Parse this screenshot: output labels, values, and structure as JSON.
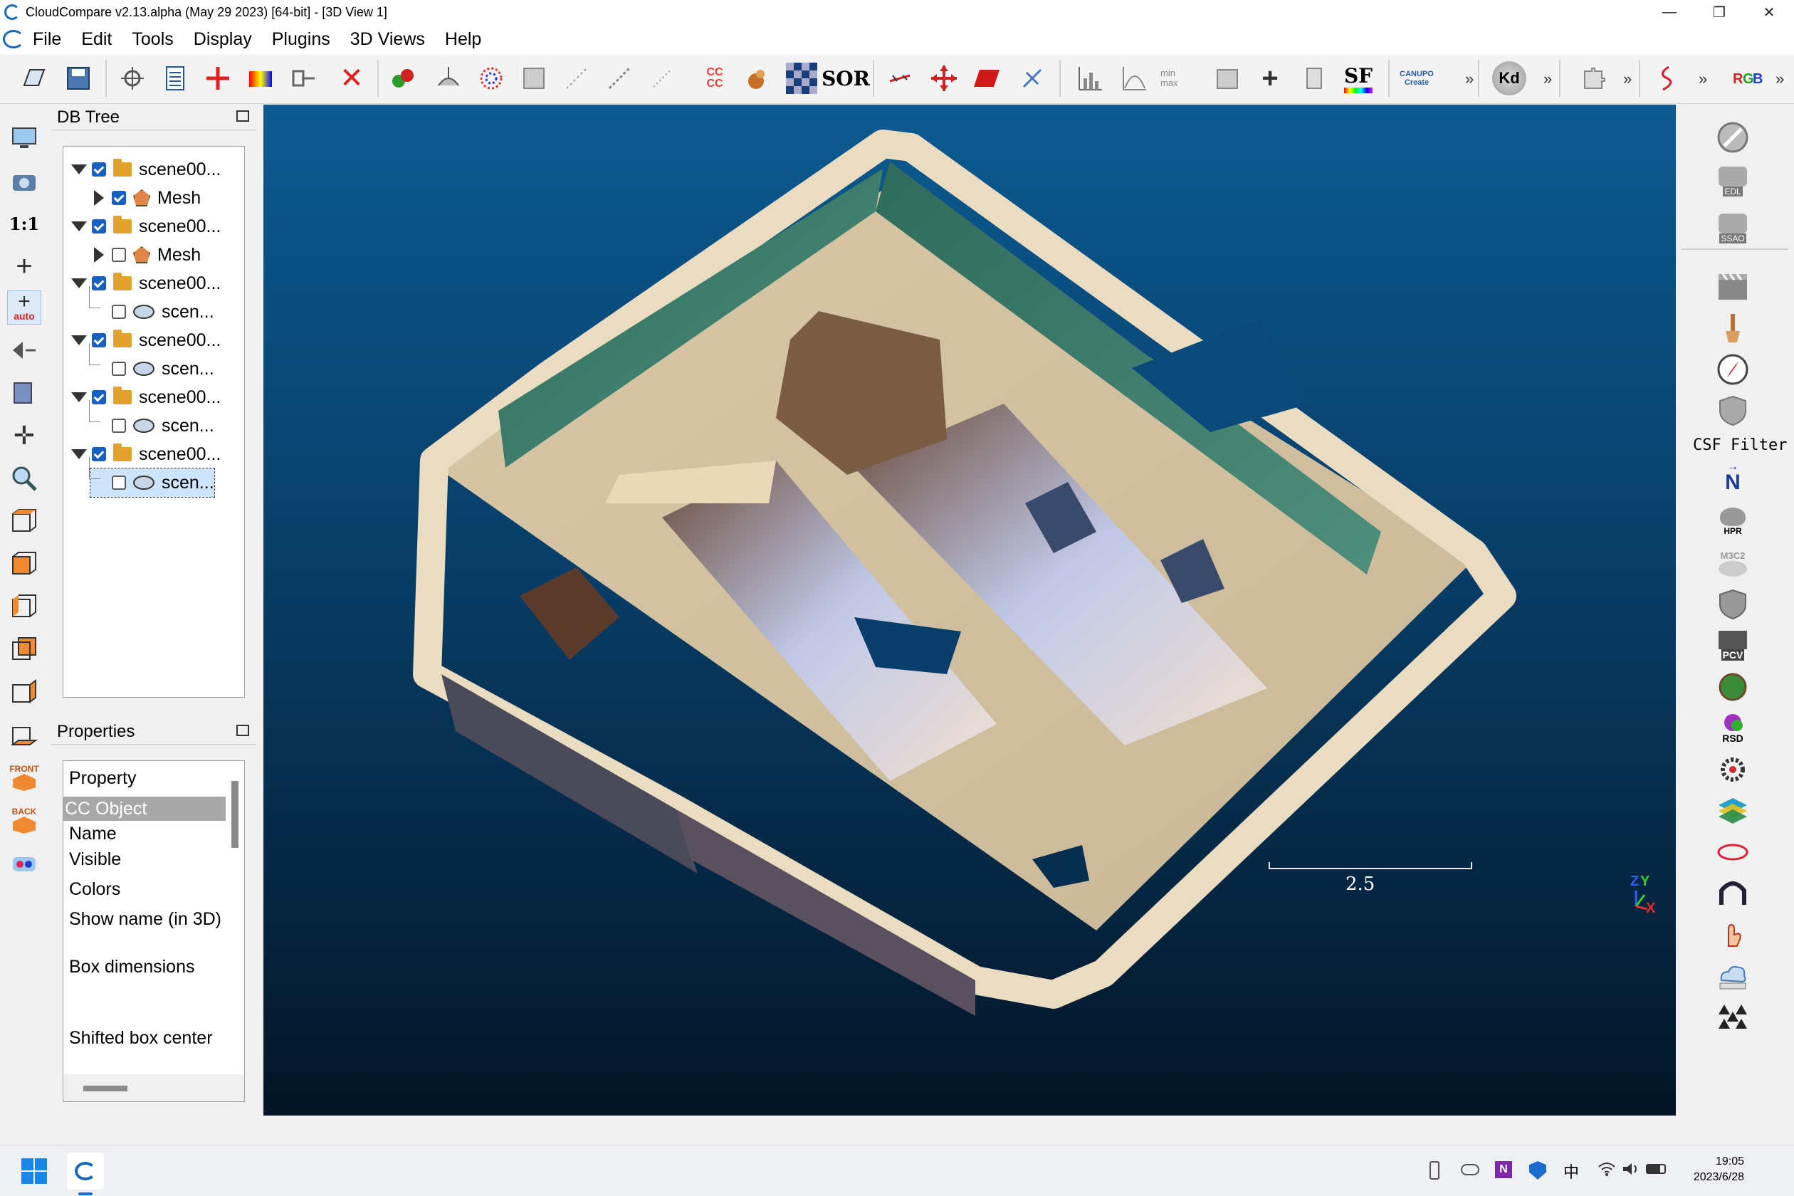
{
  "window": {
    "title": "CloudCompare v2.13.alpha (May 29 2023) [64-bit] - [3D View 1]",
    "minimize": "—",
    "maximize": "❐",
    "close": "✕"
  },
  "menu": [
    "File",
    "Edit",
    "Tools",
    "Display",
    "Plugins",
    "3D Views",
    "Help"
  ],
  "toolbar": {
    "cc_label": "CC\nCC",
    "sor_label": "SOR",
    "sf_label": "SF",
    "canupo_label": "CANUPO Create",
    "kd_label": "Kd",
    "minmax_label": "min max",
    "more": "»"
  },
  "left_tools": {
    "one_to_one": "1:1",
    "auto": "auto",
    "front": "FRONT",
    "back": "BACK"
  },
  "db_tree": {
    "title": "DB Tree",
    "nodes": [
      {
        "label": "scene00...",
        "level": 0,
        "checked": true,
        "type": "folder",
        "expanded": true
      },
      {
        "label": "Mesh",
        "level": 1,
        "checked": true,
        "type": "mesh",
        "expanded": false
      },
      {
        "label": "scene00...",
        "level": 0,
        "checked": true,
        "type": "folder",
        "expanded": true
      },
      {
        "label": "Mesh",
        "level": 1,
        "checked": false,
        "type": "mesh",
        "expanded": false
      },
      {
        "label": "scene00...",
        "level": 0,
        "checked": true,
        "type": "folder",
        "expanded": true
      },
      {
        "label": "scen...",
        "level": 1,
        "checked": false,
        "type": "cloud"
      },
      {
        "label": "scene00...",
        "level": 0,
        "checked": true,
        "type": "folder",
        "expanded": true
      },
      {
        "label": "scen...",
        "level": 1,
        "checked": false,
        "type": "cloud"
      },
      {
        "label": "scene00...",
        "level": 0,
        "checked": true,
        "type": "folder",
        "expanded": true
      },
      {
        "label": "scen...",
        "level": 1,
        "checked": false,
        "type": "cloud"
      },
      {
        "label": "scene00...",
        "level": 0,
        "checked": true,
        "type": "folder",
        "expanded": true
      },
      {
        "label": "scen...",
        "level": 1,
        "checked": false,
        "type": "cloud",
        "selected": true
      }
    ]
  },
  "properties": {
    "title": "Properties",
    "header": "Property",
    "section": "CC Object",
    "rows": [
      "Name",
      "Visible",
      "Colors",
      "Show name (in 3D)",
      "Box dimensions",
      "Shifted box center"
    ]
  },
  "view3d": {
    "scale_value": "2.5",
    "axis_z": "Z",
    "axis_y": "Y",
    "axis_x": "X"
  },
  "right_tools": {
    "edl": "EDL",
    "ssao": "SSAO",
    "csf_label": "CSF Filter",
    "north": "N",
    "hpr": "HPR",
    "m3c2": "M3C2",
    "pcv": "PCV",
    "rsd": "RSD"
  },
  "taskbar": {
    "time": "19:05",
    "date": "2023/6/28",
    "ime": "中"
  },
  "colors": {
    "view_top": "#0c5a91",
    "view_bottom": "#031526",
    "accent": "#1660c4",
    "selection": "#cde4fb"
  }
}
